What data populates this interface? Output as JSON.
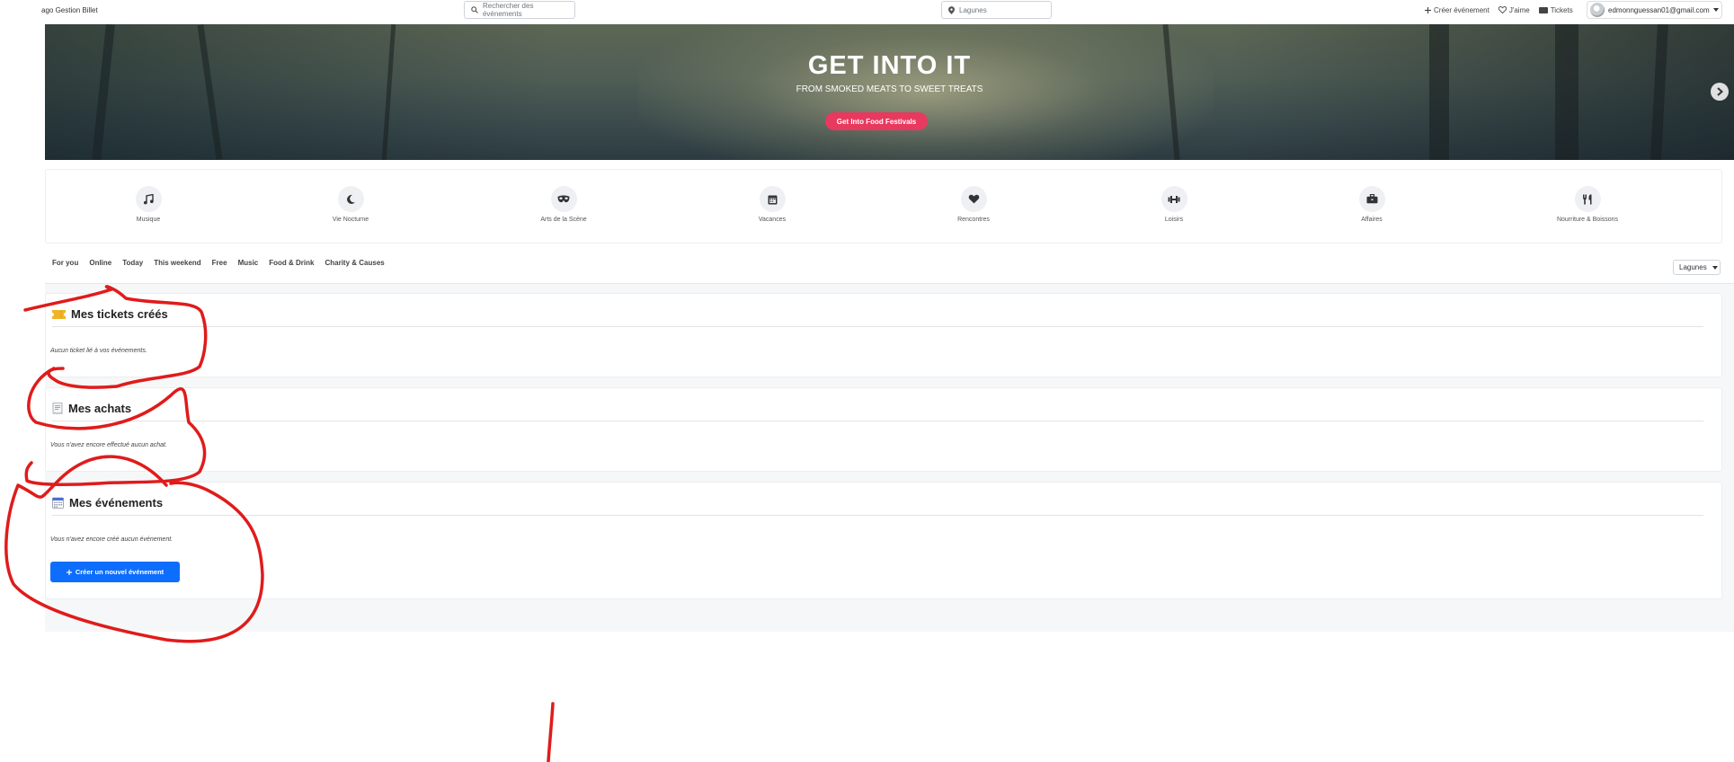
{
  "header": {
    "brand": "ago Gestion Billet",
    "search_placeholder": "Rechercher des événements",
    "location_value": "Lagunes",
    "links": [
      {
        "label": "Créer événement",
        "icon": "plus-icon"
      },
      {
        "label": "J'aime",
        "icon": "heart-icon"
      },
      {
        "label": "Tickets",
        "icon": "ticket-icon"
      }
    ],
    "user_email": "edmonnguessan01@gmail.com"
  },
  "hero": {
    "title": "GET INTO IT",
    "subtitle": "FROM SMOKED MEATS TO SWEET TREATS",
    "button": "Get Into Food Festivals"
  },
  "categories": [
    {
      "label": "Musique",
      "icon": "music-note-icon"
    },
    {
      "label": "Vie Nocturne",
      "icon": "moon-icon"
    },
    {
      "label": "Arts de la Scène",
      "icon": "mask-icon"
    },
    {
      "label": "Vacances",
      "icon": "calendar-icon"
    },
    {
      "label": "Rencontres",
      "icon": "heart-icon"
    },
    {
      "label": "Loisirs",
      "icon": "dumbbell-icon"
    },
    {
      "label": "Affaires",
      "icon": "briefcase-icon"
    },
    {
      "label": "Nourriture & Boissons",
      "icon": "utensils-icon"
    }
  ],
  "filters": {
    "tabs": [
      "For you",
      "Online",
      "Today",
      "This weekend",
      "Free",
      "Music",
      "Food & Drink",
      "Charity & Causes"
    ],
    "region_select": "Lagunes"
  },
  "sections": {
    "tickets": {
      "title": "Mes tickets créés",
      "icon": "ticket-emoji-icon",
      "message": "Aucun ticket lié à vos événements."
    },
    "purchases": {
      "title": "Mes achats",
      "icon": "receipt-emoji-icon",
      "message": "Vous n'avez encore effectué aucun achat."
    },
    "events": {
      "title": "Mes événements",
      "icon": "calendar-emoji-icon",
      "message": "Vous n'avez encore créé aucun événement.",
      "button": "Créer un nouvel événement"
    }
  },
  "colors": {
    "accent_pink": "#e8395f",
    "primary_blue": "#0d6efd",
    "annotation_red": "#e01b1b"
  }
}
